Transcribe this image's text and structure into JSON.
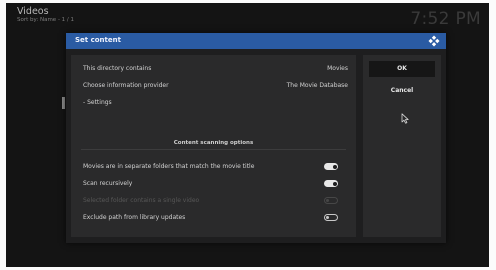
{
  "header": {
    "title": "Videos",
    "subtitle": "Sort by: Name - 1 / 1"
  },
  "clock": "7:52 PM",
  "dialog": {
    "title": "Set content",
    "rows": [
      {
        "label": "This directory contains",
        "value": "Movies"
      },
      {
        "label": "Choose information provider",
        "value": "The Movie Database"
      },
      {
        "label": "- Settings"
      }
    ],
    "section_header": "Content scanning options",
    "options": [
      {
        "label": "Movies are in separate folders that match the movie title",
        "state": "on"
      },
      {
        "label": "Scan recursively",
        "state": "on"
      },
      {
        "label": "Selected folder contains a single video",
        "state": "disabled"
      },
      {
        "label": "Exclude path from library updates",
        "state": "off"
      }
    ],
    "ok_label": "OK",
    "cancel_label": "Cancel"
  },
  "colors": {
    "title_bar": "#2a5ba3",
    "panel": "#2a2a2b",
    "dialog_bg": "#1e1e1f"
  },
  "icons": {
    "title_icon": "kodi-logo-icon",
    "cursor": "mouse-pointer-icon"
  }
}
